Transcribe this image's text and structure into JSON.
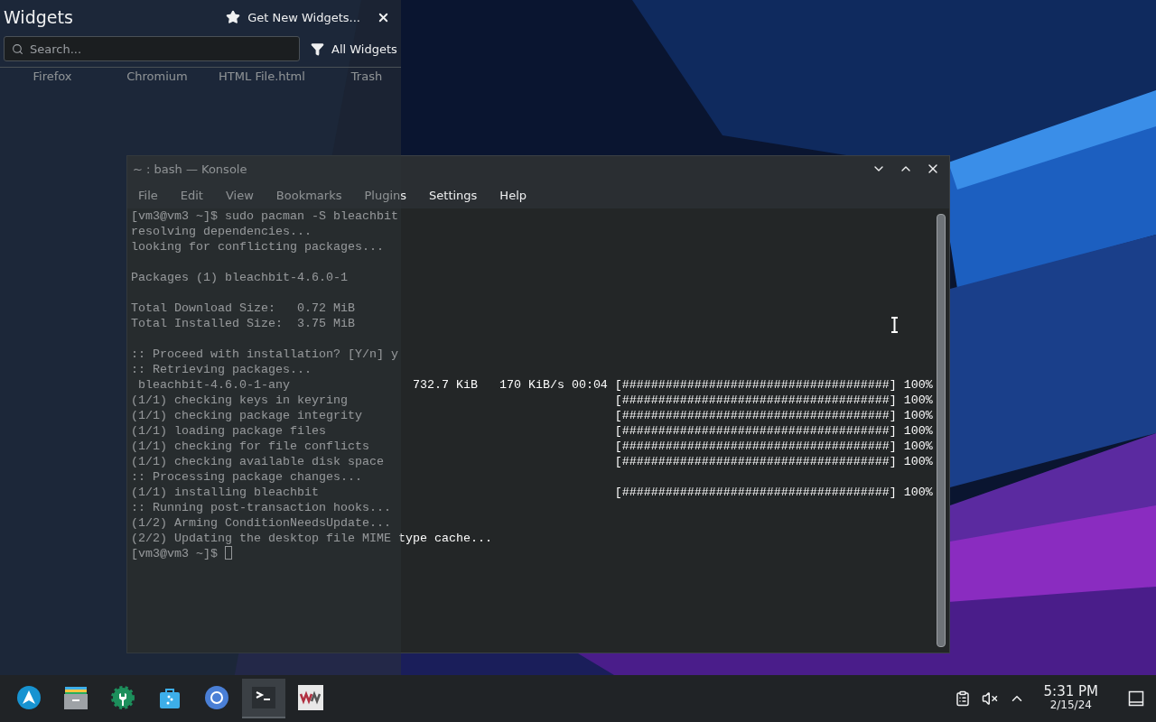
{
  "desktop": {
    "icons": [
      {
        "label": "Firefox"
      },
      {
        "label": "Chromium"
      },
      {
        "label": "HTML File.html"
      },
      {
        "label": "Trash"
      }
    ]
  },
  "konsole": {
    "title": "~ : bash — Konsole",
    "menu": [
      "File",
      "Edit",
      "View",
      "Bookmarks",
      "Plugins",
      "Settings",
      "Help"
    ],
    "blocks": [
      {
        "lines": [
          {
            "text": "[vm3@vm3 ~]$ sudo pacman -S bleachbit"
          },
          {
            "text": "resolving dependencies..."
          },
          {
            "text": "looking for conflicting packages..."
          }
        ]
      },
      {
        "lines": [
          {
            "text": "Packages (1) bleachbit-4.6.0-1"
          }
        ]
      },
      {
        "lines": [
          {
            "text": "Total Download Size:   0.72 MiB"
          },
          {
            "text": "Total Installed Size:  3.75 MiB"
          }
        ]
      },
      {
        "lines": [
          {
            "text": ":: Proceed with installation? [Y/n] y"
          },
          {
            "text": ":: Retrieving packages..."
          },
          {
            "text": " bleachbit-4.6.0-1-any",
            "transfer": "732.7 KiB   170 KiB/s 00:04",
            "progress": "[#####################################] 100%"
          },
          {
            "text": "(1/1) checking keys in keyring",
            "progress": "[#####################################] 100%"
          },
          {
            "text": "(1/1) checking package integrity",
            "progress": "[#####################################] 100%"
          },
          {
            "text": "(1/1) loading package files",
            "progress": "[#####################################] 100%"
          },
          {
            "text": "(1/1) checking for file conflicts",
            "progress": "[#####################################] 100%"
          },
          {
            "text": "(1/1) checking available disk space",
            "progress": "[#####################################] 100%"
          },
          {
            "text": ":: Processing package changes..."
          },
          {
            "text": "(1/1) installing bleachbit",
            "progress": "[#####################################] 100%"
          },
          {
            "text": ":: Running post-transaction hooks..."
          },
          {
            "text": "(1/2) Arming ConditionNeedsUpdate..."
          },
          {
            "text": "(2/2) Updating the desktop file MIME type cache..."
          },
          {
            "text": "[vm3@vm3 ~]$ ",
            "cursor": true
          }
        ]
      }
    ]
  },
  "widgets_panel": {
    "title": "Widgets",
    "get_new_button": "Get New Widgets...",
    "search": {
      "placeholder": "Search..."
    },
    "filter_button": "All Widgets"
  },
  "taskbar": {
    "apps": [
      {
        "kind": "launcher",
        "active": false
      },
      {
        "kind": "files",
        "active": false
      },
      {
        "kind": "settings",
        "active": false
      },
      {
        "kind": "store",
        "active": false
      },
      {
        "kind": "browser",
        "active": false
      },
      {
        "kind": "terminal",
        "active": true
      },
      {
        "kind": "vm",
        "active": false
      }
    ],
    "tray": [
      {
        "kind": "clipboard"
      },
      {
        "kind": "volume",
        "muted": true
      },
      {
        "kind": "expand"
      }
    ],
    "clock": {
      "time": "5:31 PM",
      "date": "2/15/24"
    }
  }
}
